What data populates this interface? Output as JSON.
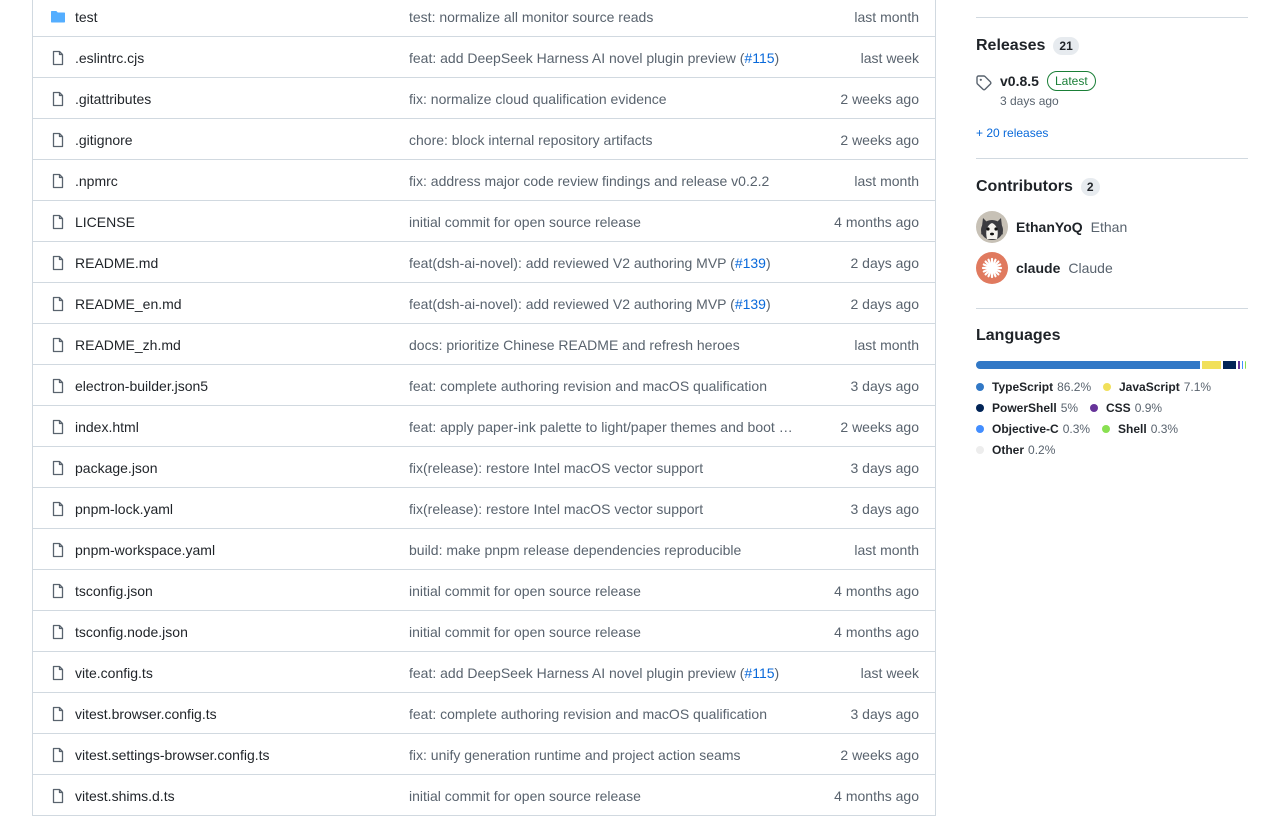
{
  "files": [
    {
      "name": "test",
      "type": "dir",
      "commit": "test: normalize all monitor source reads",
      "link": "",
      "suffix": "",
      "date": "last month"
    },
    {
      "name": ".eslintrc.cjs",
      "type": "file",
      "commit": "feat: add DeepSeek Harness AI novel plugin preview (",
      "link": "#115",
      "suffix": ")",
      "date": "last week"
    },
    {
      "name": ".gitattributes",
      "type": "file",
      "commit": "fix: normalize cloud qualification evidence",
      "link": "",
      "suffix": "",
      "date": "2 weeks ago"
    },
    {
      "name": ".gitignore",
      "type": "file",
      "commit": "chore: block internal repository artifacts",
      "link": "",
      "suffix": "",
      "date": "2 weeks ago"
    },
    {
      "name": ".npmrc",
      "type": "file",
      "commit": "fix: address major code review findings and release v0.2.2",
      "link": "",
      "suffix": "",
      "date": "last month"
    },
    {
      "name": "LICENSE",
      "type": "file",
      "commit": "initial commit for open source release",
      "link": "",
      "suffix": "",
      "date": "4 months ago"
    },
    {
      "name": "README.md",
      "type": "file",
      "commit": "feat(dsh-ai-novel): add reviewed V2 authoring MVP (",
      "link": "#139",
      "suffix": ")",
      "date": "2 days ago"
    },
    {
      "name": "README_en.md",
      "type": "file",
      "commit": "feat(dsh-ai-novel): add reviewed V2 authoring MVP (",
      "link": "#139",
      "suffix": ")",
      "date": "2 days ago"
    },
    {
      "name": "README_zh.md",
      "type": "file",
      "commit": "docs: prioritize Chinese README and refresh heroes",
      "link": "",
      "suffix": "",
      "date": "last month"
    },
    {
      "name": "electron-builder.json5",
      "type": "file",
      "commit": "feat: complete authoring revision and macOS qualification",
      "link": "",
      "suffix": "",
      "date": "3 days ago"
    },
    {
      "name": "index.html",
      "type": "file",
      "commit": "feat: apply paper-ink palette to light/paper themes and boot …",
      "link": "",
      "suffix": "",
      "date": "2 weeks ago"
    },
    {
      "name": "package.json",
      "type": "file",
      "commit": "fix(release): restore Intel macOS vector support",
      "link": "",
      "suffix": "",
      "date": "3 days ago"
    },
    {
      "name": "pnpm-lock.yaml",
      "type": "file",
      "commit": "fix(release): restore Intel macOS vector support",
      "link": "",
      "suffix": "",
      "date": "3 days ago"
    },
    {
      "name": "pnpm-workspace.yaml",
      "type": "file",
      "commit": "build: make pnpm release dependencies reproducible",
      "link": "",
      "suffix": "",
      "date": "last month"
    },
    {
      "name": "tsconfig.json",
      "type": "file",
      "commit": "initial commit for open source release",
      "link": "",
      "suffix": "",
      "date": "4 months ago"
    },
    {
      "name": "tsconfig.node.json",
      "type": "file",
      "commit": "initial commit for open source release",
      "link": "",
      "suffix": "",
      "date": "4 months ago"
    },
    {
      "name": "vite.config.ts",
      "type": "file",
      "commit": "feat: add DeepSeek Harness AI novel plugin preview (",
      "link": "#115",
      "suffix": ")",
      "date": "last week"
    },
    {
      "name": "vitest.browser.config.ts",
      "type": "file",
      "commit": "feat: complete authoring revision and macOS qualification",
      "link": "",
      "suffix": "",
      "date": "3 days ago"
    },
    {
      "name": "vitest.settings-browser.config.ts",
      "type": "file",
      "commit": "fix: unify generation runtime and project action seams",
      "link": "",
      "suffix": "",
      "date": "2 weeks ago"
    },
    {
      "name": "vitest.shims.d.ts",
      "type": "file",
      "commit": "initial commit for open source release",
      "link": "",
      "suffix": "",
      "date": "4 months ago"
    }
  ],
  "releases": {
    "heading": "Releases",
    "count": "21",
    "latest_tag": "v0.8.5",
    "latest_badge": "Latest",
    "latest_time": "3 days ago",
    "more_link": "+ 20 releases"
  },
  "contributors": {
    "heading": "Contributors",
    "count": "2",
    "people": [
      {
        "login": "EthanYoQ",
        "name": "Ethan",
        "avatar": "husky-dog-avatar"
      },
      {
        "login": "claude",
        "name": "Claude",
        "avatar": "claude-starburst-avatar"
      }
    ]
  },
  "languages": {
    "heading": "Languages",
    "items": [
      {
        "name": "TypeScript",
        "percent": "86.2%",
        "value": 86.2,
        "color": "#3178c6"
      },
      {
        "name": "JavaScript",
        "percent": "7.1%",
        "value": 7.1,
        "color": "#f1e05a"
      },
      {
        "name": "PowerShell",
        "percent": "5%",
        "value": 5.0,
        "color": "#012456"
      },
      {
        "name": "CSS",
        "percent": "0.9%",
        "value": 0.9,
        "color": "#663399"
      },
      {
        "name": "Objective-C",
        "percent": "0.3%",
        "value": 0.3,
        "color": "#438eff"
      },
      {
        "name": "Shell",
        "percent": "0.3%",
        "value": 0.3,
        "color": "#89e051"
      },
      {
        "name": "Other",
        "percent": "0.2%",
        "value": 0.2,
        "color": "#ededed"
      }
    ]
  },
  "colors": {
    "link": "#0969da",
    "muted": "#59636e",
    "border": "#d1d9e0",
    "folder": "#54aeff",
    "latest": "#1a7f37"
  }
}
